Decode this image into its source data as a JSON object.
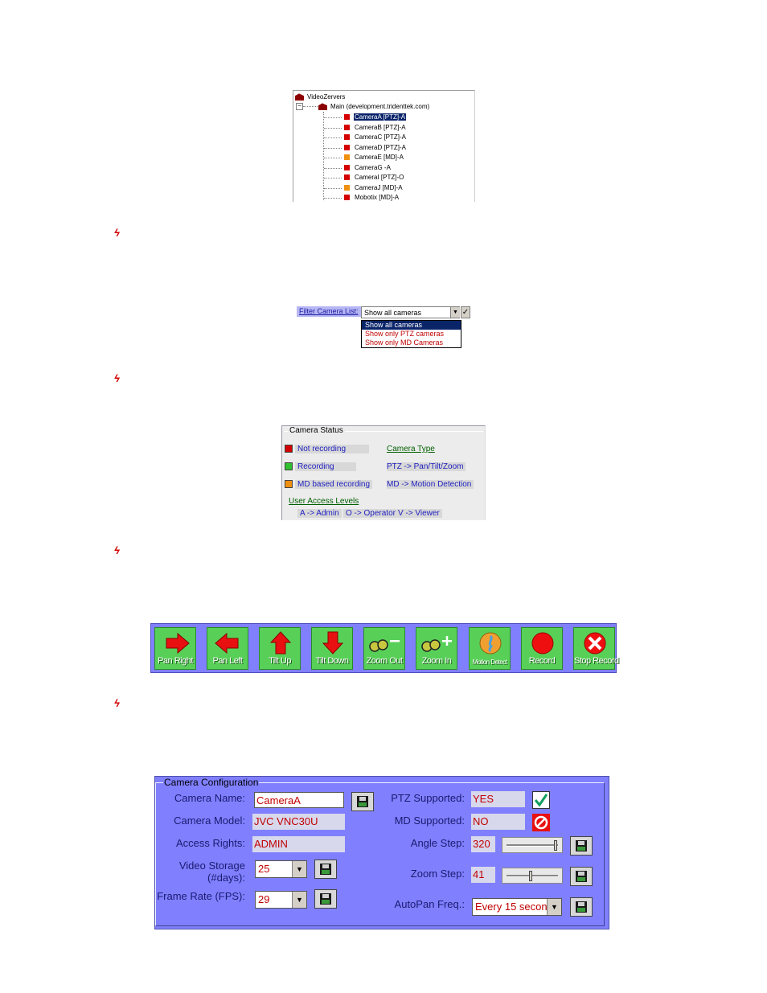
{
  "tree": {
    "root": "VideoZervers",
    "server": "Main (development.tridenttek.com)",
    "cameras": [
      {
        "label": "CameraA [PTZ]-A",
        "color": "red",
        "selected": true
      },
      {
        "label": "CameraB [PTZ]-A",
        "color": "red",
        "selected": false
      },
      {
        "label": "CameraC [PTZ]-A",
        "color": "red",
        "selected": false
      },
      {
        "label": "CameraD [PTZ]-A",
        "color": "red",
        "selected": false
      },
      {
        "label": "CameraE [MD]-A",
        "color": "orange",
        "selected": false
      },
      {
        "label": "CameraG -A",
        "color": "red",
        "selected": false
      },
      {
        "label": "CameraI [PTZ]-O",
        "color": "red",
        "selected": false
      },
      {
        "label": "CameraJ [MD]-A",
        "color": "orange",
        "selected": false
      },
      {
        "label": "Mobotix [MD]-A",
        "color": "red",
        "selected": false
      }
    ]
  },
  "filter": {
    "label": "Filter Camera List:",
    "selected": "Show all cameras",
    "check": "✓",
    "options": [
      "Show all cameras",
      "Show only PTZ cameras",
      "Show only MD Cameras"
    ]
  },
  "status": {
    "title": "Camera Status",
    "not_recording": "Not recording",
    "recording": "Recording",
    "md_recording": "MD based recording",
    "camera_type": "Camera Type",
    "ptz_desc": "PTZ -> Pan/Tilt/Zoom",
    "md_desc": "MD -> Motion Detection",
    "access_levels": "User Access Levels",
    "admin": "A -> Admin",
    "operator": "O -> Operator",
    "viewer": "V -> Viewer",
    "colors": {
      "not_recording": "#d40000",
      "recording": "#30c030",
      "md": "#f09010"
    }
  },
  "toolbar": {
    "pan_right": "Pan Right",
    "pan_left": "Pan Left",
    "tilt_up": "Tilt Up",
    "tilt_down": "Tilt Down",
    "zoom_out": "Zoom Out",
    "zoom_in": "Zoom In",
    "motion_detect": "Motion Detect",
    "record": "Record",
    "stop_record": "Stop Record"
  },
  "config": {
    "title": "Camera Configuration",
    "camera_name_label": "Camera Name:",
    "camera_name": "CameraA",
    "camera_model_label": "Camera Model:",
    "camera_model": "JVC VNC30U",
    "access_rights_label": "Access Rights:",
    "access_rights": "ADMIN",
    "video_storage_label": "Video Storage",
    "video_storage_label2": "(#days):",
    "video_storage": "25",
    "frame_rate_label": "Frame Rate (FPS):",
    "frame_rate": "29",
    "ptz_label": "PTZ Supported:",
    "ptz": "YES",
    "md_label": "MD Supported:",
    "md": "NO",
    "angle_label": "Angle Step:",
    "angle": "320",
    "angle_level": 0.95,
    "zoom_label": "Zoom Step:",
    "zoom": "41",
    "zoom_level": 0.45,
    "autopan_label": "AutoPan Freq.:",
    "autopan": "Every 15 secon"
  }
}
